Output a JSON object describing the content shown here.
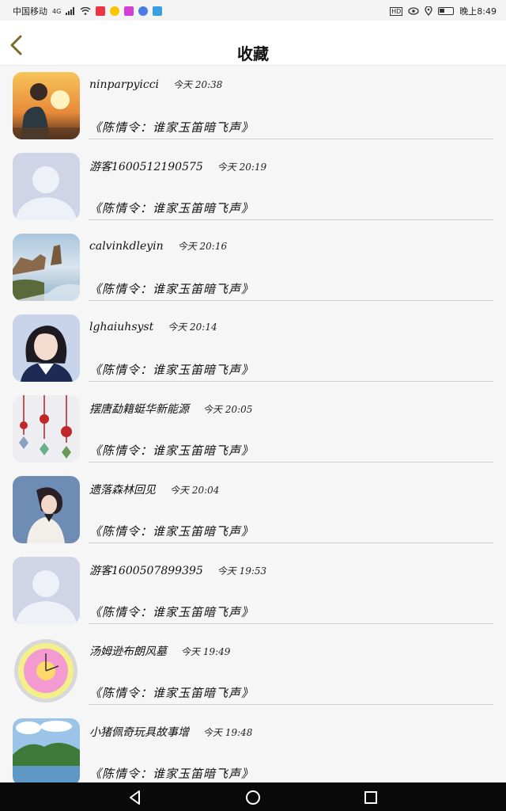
{
  "status_bar": {
    "carrier": "中国移动",
    "network": "4G",
    "time": "晚上8:49",
    "icons": [
      "signal-icon",
      "wifi-icon",
      "app-icon-1",
      "app-icon-2",
      "app-icon-3",
      "app-icon-4",
      "app-icon-5",
      "hd-icon",
      "eye-icon",
      "location-icon",
      "battery-icon"
    ]
  },
  "header": {
    "title": "收藏",
    "back_icon": "chevron-left-icon",
    "accent_color": "#7a6a2a"
  },
  "items": [
    {
      "username": "ninparpyicci",
      "time": "今天 20:38",
      "post": "《陈情令：谁家玉笛暗飞声》",
      "avatar": "sunset-person"
    },
    {
      "username": "游客1600512190575",
      "time": "今天 20:19",
      "post": "《陈情令：谁家玉笛暗飞声》",
      "avatar": "default-person"
    },
    {
      "username": "calvinkdleyin",
      "time": "今天 20:16",
      "post": "《陈情令：谁家玉笛暗飞声》",
      "avatar": "sea-cliff"
    },
    {
      "username": "lghaiuhsyst",
      "time": "今天 20:14",
      "post": "《陈情令：谁家玉笛暗飞声》",
      "avatar": "girl-portrait"
    },
    {
      "username": "摆唐勐籍蜓华新能源",
      "time": "今天 20:05",
      "post": "《陈情令：谁家玉笛暗飞声》",
      "avatar": "chinese-knots"
    },
    {
      "username": "遗落森林回见",
      "time": "今天 20:04",
      "post": "《陈情令：谁家玉笛暗飞声》",
      "avatar": "girl-blue"
    },
    {
      "username": "游客1600507899395",
      "time": "今天 19:53",
      "post": "《陈情令：谁家玉笛暗飞声》",
      "avatar": "default-person"
    },
    {
      "username": "汤姆逊布朗风墓",
      "time": "今天 19:49",
      "post": "《陈情令：谁家玉笛暗飞声》",
      "avatar": "pink-clock"
    },
    {
      "username": "小猪佩奇玩具故事增",
      "time": "今天 19:48",
      "post": "《陈情令：谁家玉笛暗飞声》",
      "avatar": "lake-mountain"
    }
  ],
  "navbar": {
    "icons": [
      "back-triangle-icon",
      "home-circle-icon",
      "recents-square-icon"
    ]
  }
}
